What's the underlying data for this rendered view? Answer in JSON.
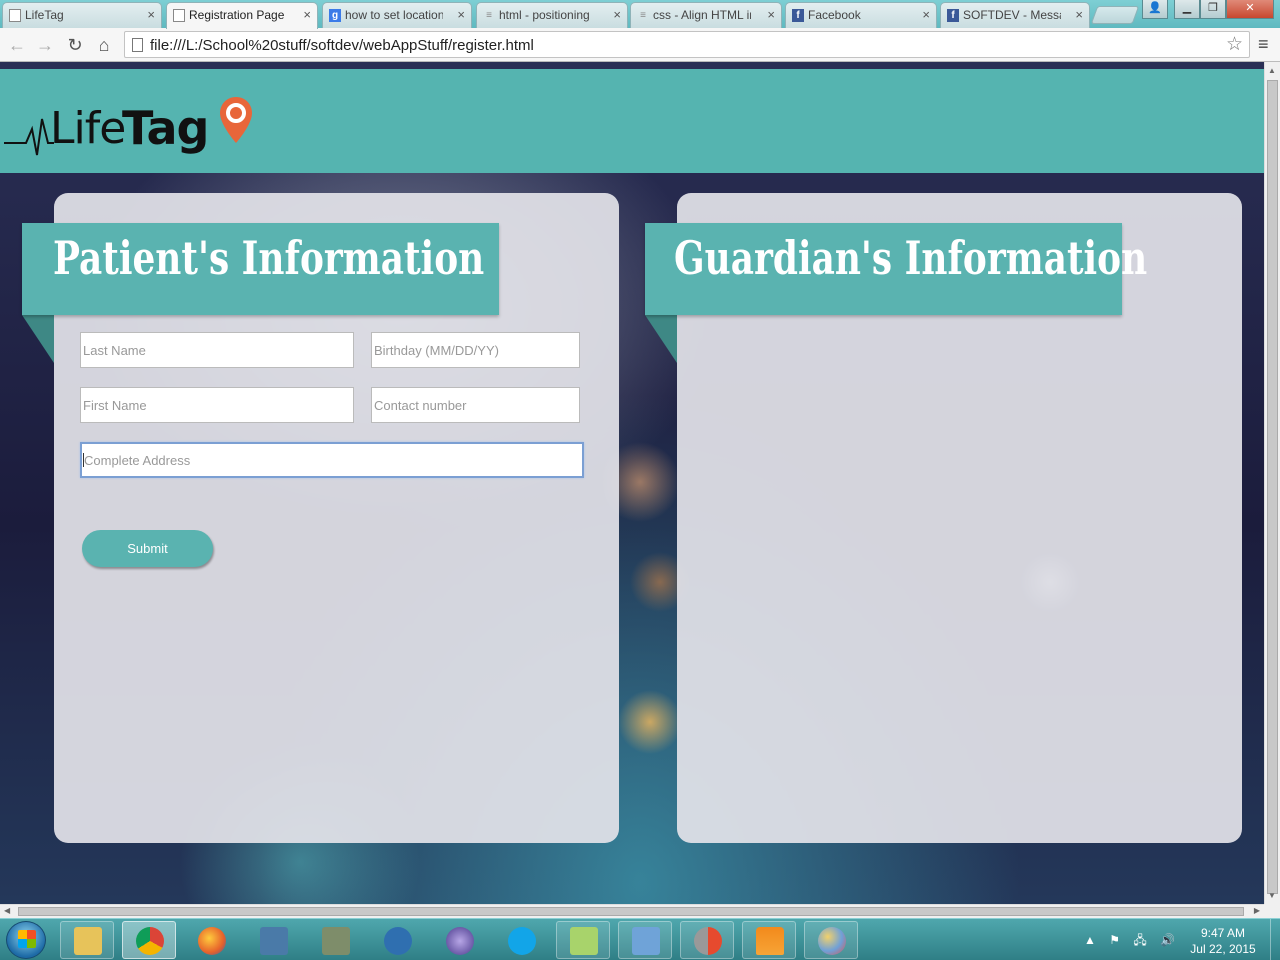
{
  "browser": {
    "tabs": [
      {
        "title": "LifeTag",
        "icon": "page-icon"
      },
      {
        "title": "Registration Page",
        "icon": "page-icon"
      },
      {
        "title": "how to set location",
        "icon": "google-icon"
      },
      {
        "title": "html - positioning",
        "icon": "stackoverflow-icon"
      },
      {
        "title": "css - Align HTML in",
        "icon": "stackoverflow-icon"
      },
      {
        "title": "Facebook",
        "icon": "facebook-icon"
      },
      {
        "title": "SOFTDEV - Messag",
        "icon": "facebook-icon"
      }
    ],
    "active_tab_index": 1,
    "address": "file:///L:/School%20stuff/softdev/webAppStuff/register.html"
  },
  "site": {
    "logo_light": "Life",
    "logo_bold": "Tag",
    "brand_color": "#55b4b0"
  },
  "patient": {
    "heading": "Patient's Information",
    "fields": {
      "last_name": "Last Name",
      "birthday": "Birthday (MM/DD/YY)",
      "first_name": "First Name",
      "contact": "Contact number",
      "address": "Complete Address"
    },
    "submit_label": "Submit"
  },
  "guardian": {
    "heading": "Guardian's Information"
  },
  "taskbar": {
    "apps": [
      "file-explorer-icon",
      "chrome-icon",
      "firefox-icon",
      "computer-icon",
      "scanner-icon",
      "network-icon",
      "eclipse-icon",
      "skype-icon",
      "notepad-icon",
      "photo-viewer-icon",
      "recovery-icon",
      "vlc-icon",
      "paint-icon"
    ],
    "time": "9:47 AM",
    "date": "Jul 22, 2015"
  }
}
